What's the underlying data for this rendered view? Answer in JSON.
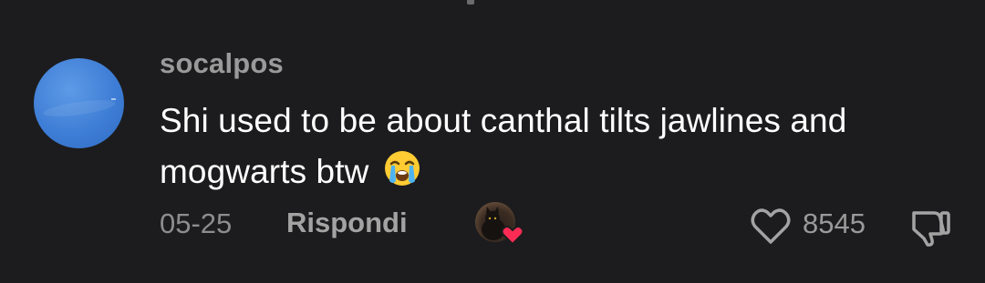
{
  "comment": {
    "username": "socalpos",
    "text": "Shi used to be about canthal tilts jawlines and mogwarts btw",
    "emoji": "loudly-crying-face",
    "date": "05-25",
    "reply_label": "Rispondi",
    "creator_liked": true,
    "like_count": "8545"
  },
  "colors": {
    "background": "#1c1c1e",
    "username": "#9a9a9a",
    "text": "#ffffff",
    "meta": "#8d8d8d",
    "heart_badge": "#fe2c55"
  },
  "icons": {
    "like": "heart-outline-icon",
    "dislike": "thumbs-down-icon",
    "creator_badge": "heart-icon"
  }
}
